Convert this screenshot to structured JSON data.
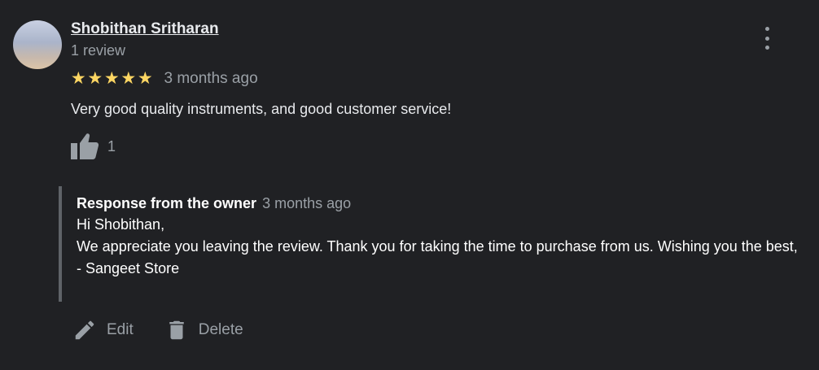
{
  "reviewer": {
    "name": "Shobithan Sritharan",
    "review_count": "1 review",
    "avatar_icon": "user-avatar"
  },
  "rating": {
    "stars": 5,
    "max_stars": 5,
    "star_glyph": "★",
    "star_color": "#fdd663",
    "date": "3 months ago"
  },
  "review_text": "Very good quality instruments, and good customer service!",
  "likes": {
    "icon": "thumb-up-icon",
    "count": "1"
  },
  "more_menu_icon": "more-vert-icon",
  "owner_response": {
    "label": "Response from the owner",
    "date": "3 months ago",
    "lines": [
      "Hi Shobithan,",
      "We appreciate you leaving the review. Thank you for taking the time to purchase from us. Wishing you the best,",
      "- Sangeet Store"
    ]
  },
  "actions": {
    "edit_label": "Edit",
    "edit_icon": "pencil-icon",
    "delete_label": "Delete",
    "delete_icon": "trash-icon"
  }
}
